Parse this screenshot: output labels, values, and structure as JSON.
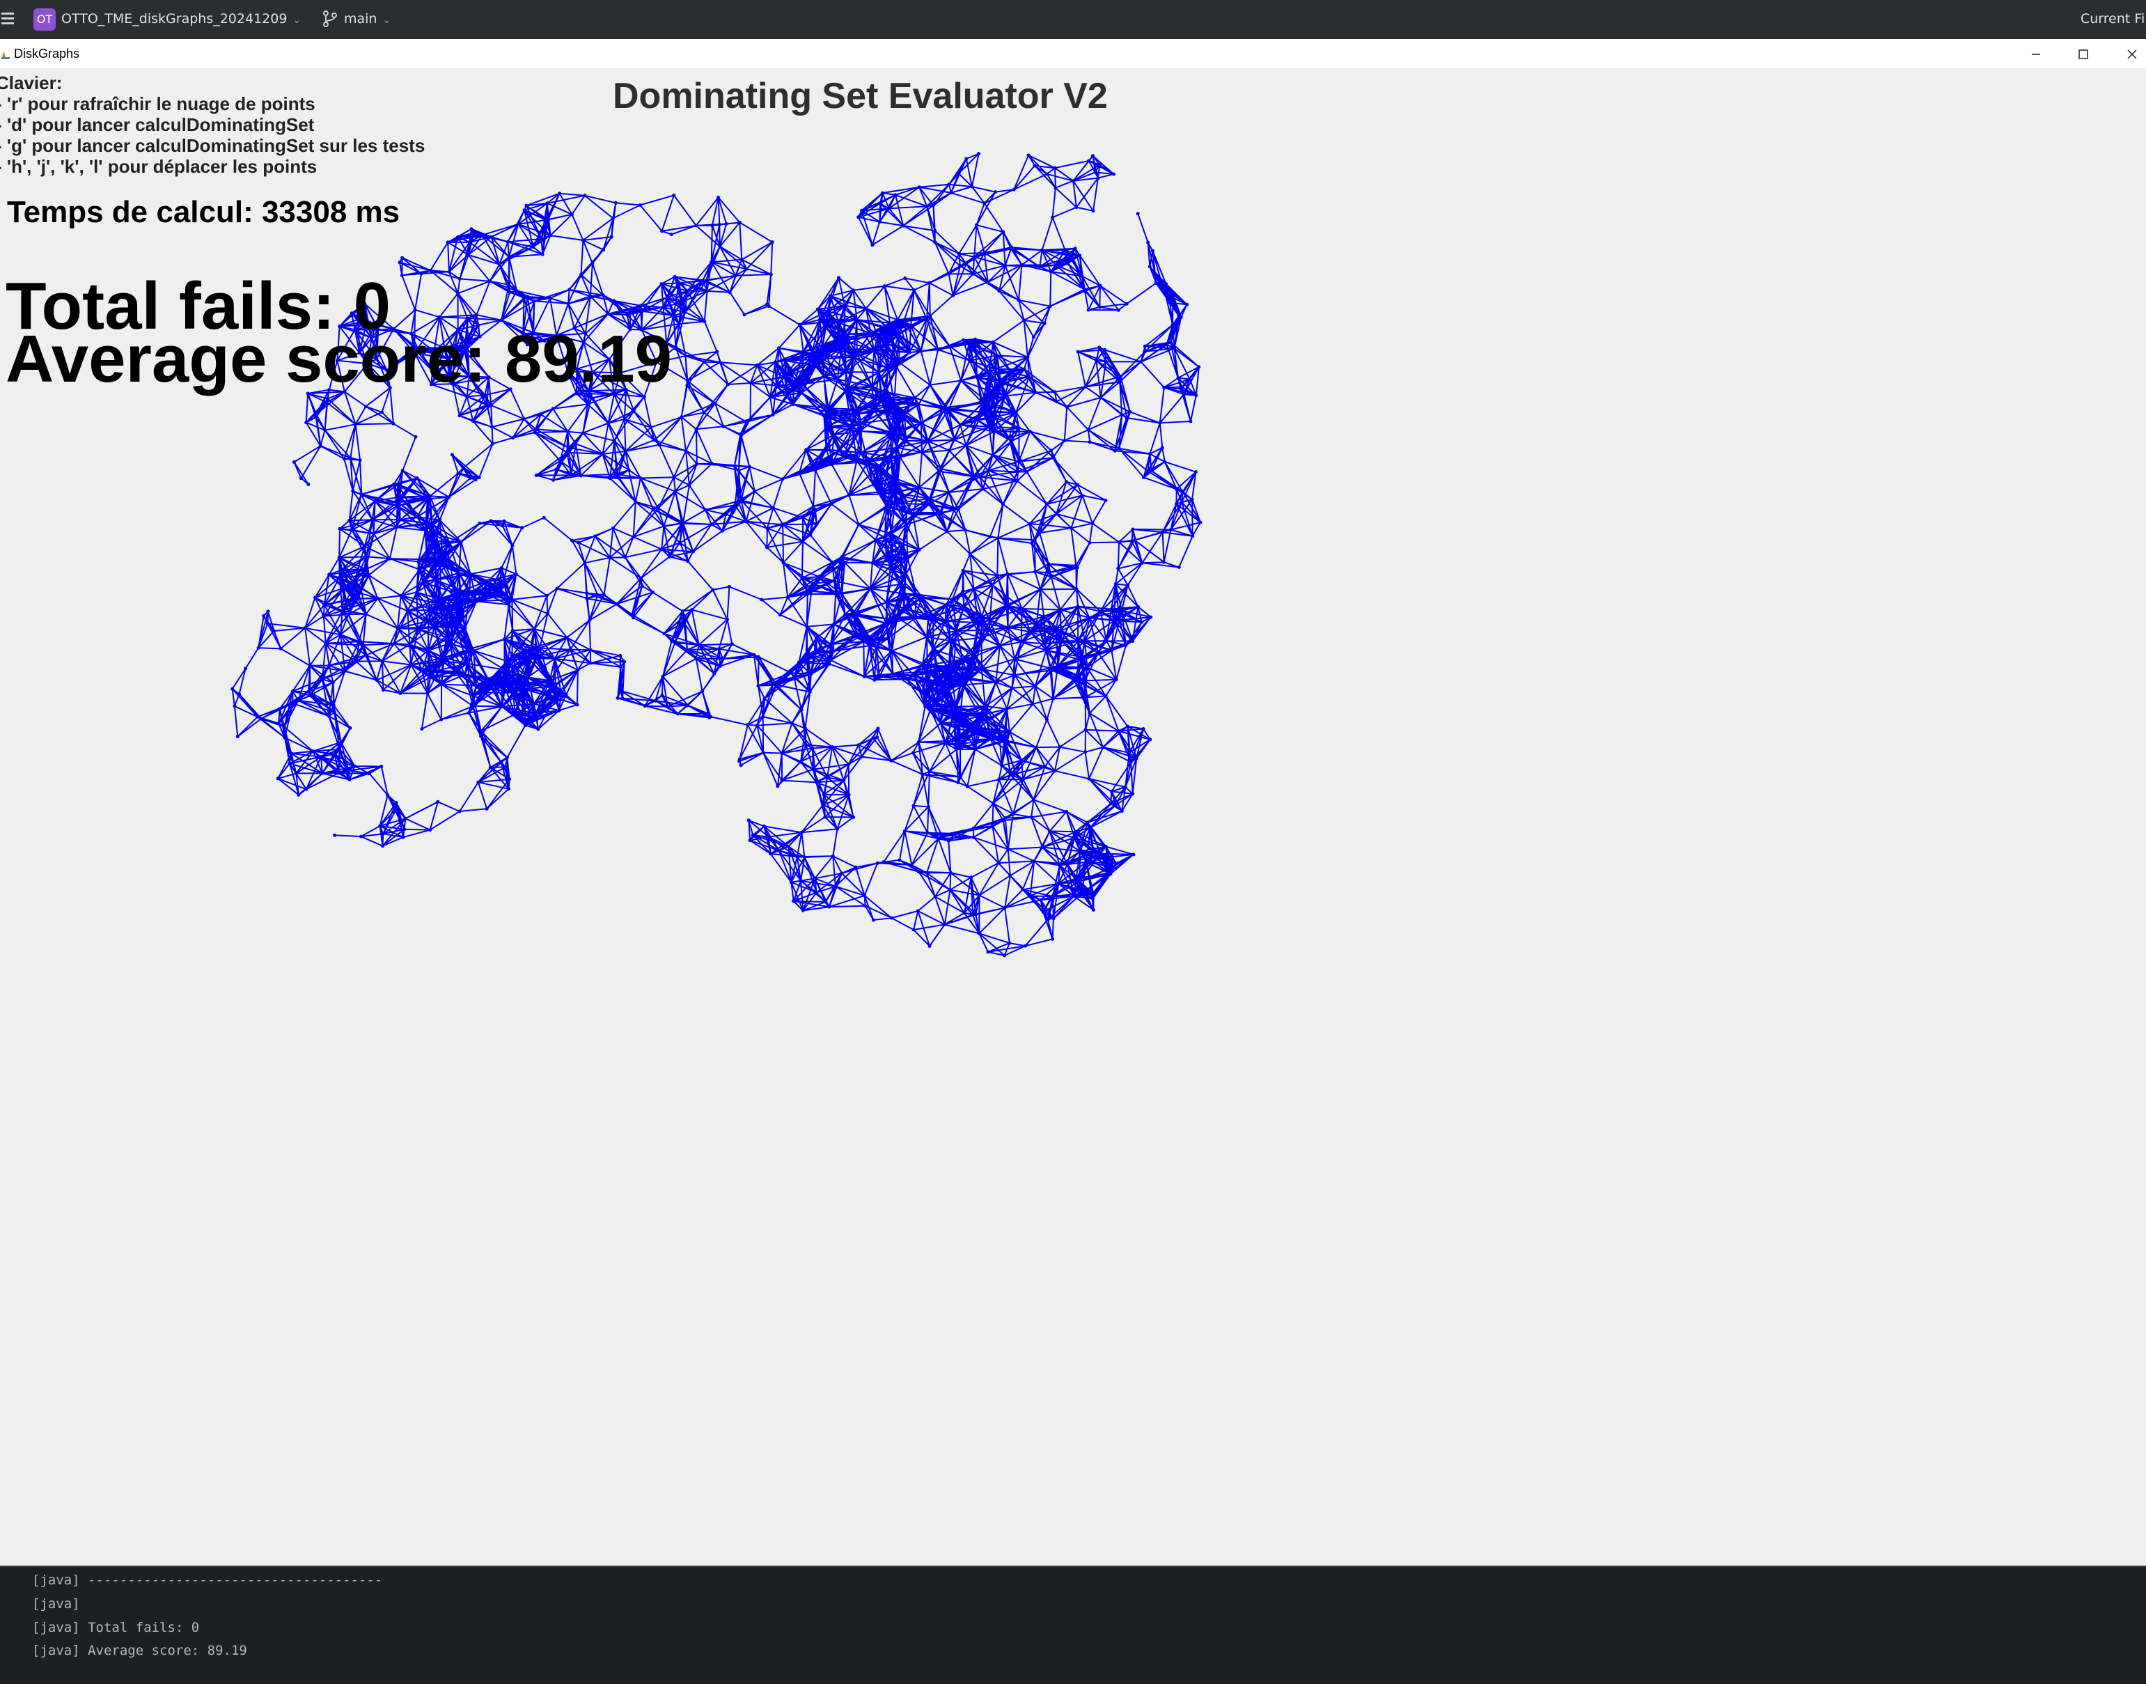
{
  "ide": {
    "project_badge": "OT",
    "project_name": "OTTO_TME_diskGraphs_20241209",
    "branch": "main",
    "current_file_label": "Current Fil"
  },
  "window": {
    "title": "DiskGraphs"
  },
  "canvas": {
    "title": "Dominating Set Evaluator V2",
    "help": [
      "Clavier:",
      "- 'r' pour rafraîchir le nuage de points",
      "- 'd' pour lancer calculDominatingSet",
      "- 'g' pour lancer calculDominatingSet sur les tests",
      "- 'h', 'j', 'k', 'l' pour déplacer les points"
    ],
    "calc_time": "Temps de calcul: 33308 ms",
    "total_fails": "Total fails: 0",
    "average_score": "Average score: 89.19",
    "graph_color": "#0000ee",
    "background_color": "#efefef"
  },
  "console": {
    "lines": [
      "[java] -------------------------------------",
      "[java]",
      "[java] Total fails: 0",
      "[java] Average score: 89.19"
    ]
  }
}
